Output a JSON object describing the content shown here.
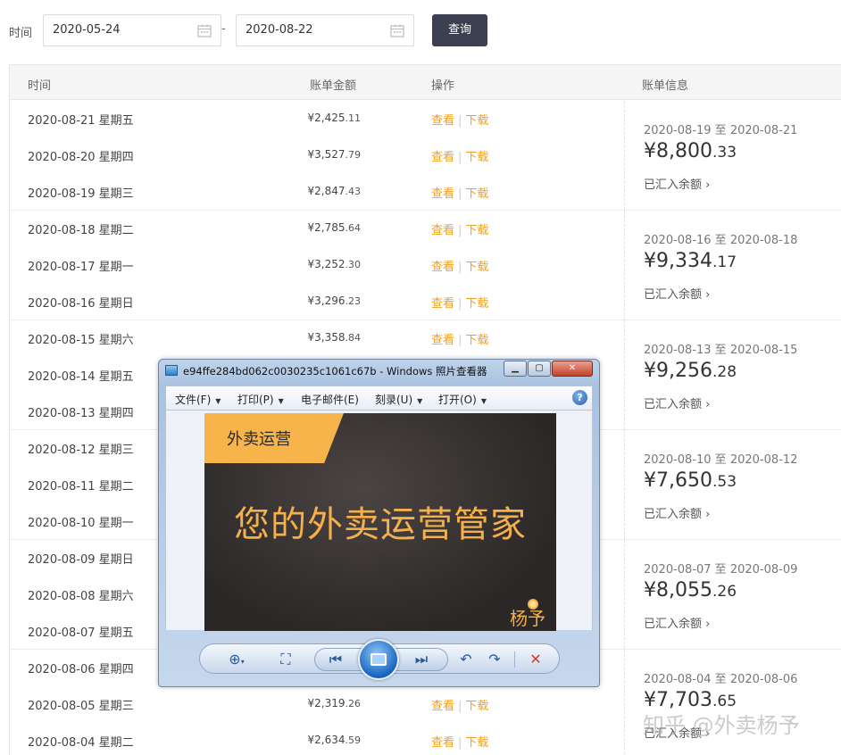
{
  "filter": {
    "label": "时间",
    "start_date": "2020-05-24",
    "end_date": "2020-08-22",
    "separator": "-",
    "query_button": "查询"
  },
  "table": {
    "headers": {
      "time": "时间",
      "amount": "账单金额",
      "ops": "操作",
      "info": "账单信息"
    },
    "ops": {
      "view": "查看",
      "sep": "|",
      "download": "下载"
    },
    "groups": [
      {
        "rows": [
          {
            "date": "2020-08-21 星期五",
            "amount_int": "¥2,425",
            "amount_dec": ".11"
          },
          {
            "date": "2020-08-20 星期四",
            "amount_int": "¥3,527",
            "amount_dec": ".79"
          },
          {
            "date": "2020-08-19 星期三",
            "amount_int": "¥2,847",
            "amount_dec": ".43"
          }
        ],
        "range": "2020-08-19 至 2020-08-21",
        "total_int": "¥8,800",
        "total_dec": ".33",
        "status": "已汇入余额 ›"
      },
      {
        "rows": [
          {
            "date": "2020-08-18 星期二",
            "amount_int": "¥2,785",
            "amount_dec": ".64"
          },
          {
            "date": "2020-08-17 星期一",
            "amount_int": "¥3,252",
            "amount_dec": ".30"
          },
          {
            "date": "2020-08-16 星期日",
            "amount_int": "¥3,296",
            "amount_dec": ".23"
          }
        ],
        "range": "2020-08-16 至 2020-08-18",
        "total_int": "¥9,334",
        "total_dec": ".17",
        "status": "已汇入余额 ›"
      },
      {
        "rows": [
          {
            "date": "2020-08-15 星期六",
            "amount_int": "¥3,358",
            "amount_dec": ".84"
          },
          {
            "date": "2020-08-14 星期五",
            "amount_int": "",
            "amount_dec": ""
          },
          {
            "date": "2020-08-13 星期四",
            "amount_int": "",
            "amount_dec": ""
          }
        ],
        "range": "2020-08-13 至 2020-08-15",
        "total_int": "¥9,256",
        "total_dec": ".28",
        "status": "已汇入余额 ›"
      },
      {
        "rows": [
          {
            "date": "2020-08-12 星期三",
            "amount_int": "",
            "amount_dec": ""
          },
          {
            "date": "2020-08-11 星期二",
            "amount_int": "",
            "amount_dec": ""
          },
          {
            "date": "2020-08-10 星期一",
            "amount_int": "",
            "amount_dec": ""
          }
        ],
        "range": "2020-08-10 至 2020-08-12",
        "total_int": "¥7,650",
        "total_dec": ".53",
        "status": "已汇入余额 ›"
      },
      {
        "rows": [
          {
            "date": "2020-08-09 星期日",
            "amount_int": "",
            "amount_dec": ""
          },
          {
            "date": "2020-08-08 星期六",
            "amount_int": "",
            "amount_dec": ""
          },
          {
            "date": "2020-08-07 星期五",
            "amount_int": "",
            "amount_dec": ""
          }
        ],
        "range": "2020-08-07 至 2020-08-09",
        "total_int": "¥8,055",
        "total_dec": ".26",
        "status": "已汇入余额 ›"
      },
      {
        "rows": [
          {
            "date": "2020-08-06 星期四",
            "amount_int": "",
            "amount_dec": ""
          },
          {
            "date": "2020-08-05 星期三",
            "amount_int": "¥2,319",
            "amount_dec": ".26"
          },
          {
            "date": "2020-08-04 星期二",
            "amount_int": "¥2,634",
            "amount_dec": ".59"
          }
        ],
        "range": "2020-08-04 至 2020-08-06",
        "total_int": "¥7,703",
        "total_dec": ".65",
        "status": "已汇入余额 ›"
      }
    ]
  },
  "viewer": {
    "title": "e94ffe284bd062c0030235c1061c67b - Windows 照片查看器",
    "menu": [
      "文件(F)",
      "打印(P)",
      "电子邮件(E)",
      "刻录(U)",
      "打开(O)"
    ],
    "photo_tag": "外卖运营",
    "photo_headline": "您的外卖运营管家",
    "photo_signature": "杨予",
    "icons": {
      "zoom": "zoom-icon",
      "fit": "fit-window-icon",
      "prev": "previous-icon",
      "slideshow": "slideshow-icon",
      "next": "next-icon",
      "rotate_left": "rotate-counterclockwise-icon",
      "rotate_right": "rotate-clockwise-icon",
      "delete": "delete-icon"
    }
  },
  "watermark": "知乎 @外卖杨予",
  "colors": {
    "accent_orange": "#f0a020",
    "button_dark": "#3b3f4f",
    "photo_gold": "#f5b04a"
  }
}
